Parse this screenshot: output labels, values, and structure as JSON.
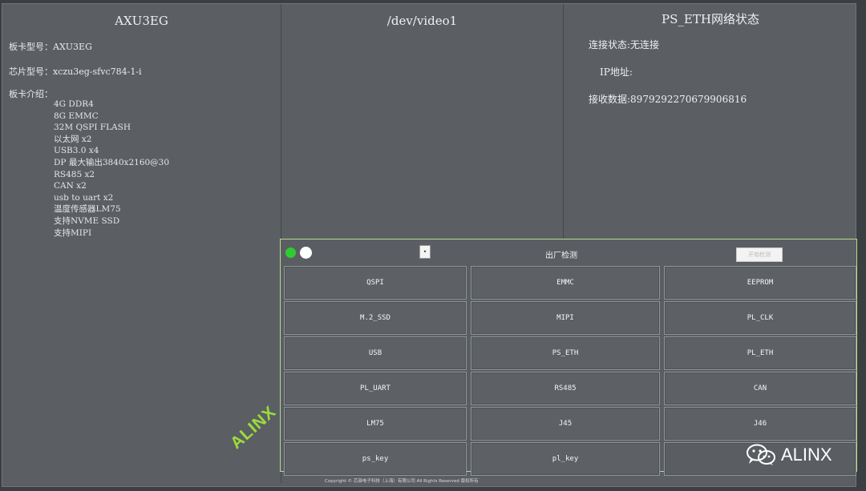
{
  "board": {
    "title": "AXU3EG",
    "model_line": "板卡型号：AXU3EG",
    "chip_line": "芯片型号：xczu3eg-sfvc784-1-i",
    "intro_label": "板卡介绍：",
    "features": [
      "4G DDR4",
      "8G EMMC",
      "32M QSPI FLASH",
      "以太网 x2",
      "USB3.0 x4",
      "DP 最大输出3840x2160@30",
      "RS485 x2",
      "CAN x2",
      "usb to uart x2",
      "温度传感器LM75",
      "支持NVME SSD",
      "支持MIPI"
    ]
  },
  "video": {
    "title": "/dev/video1"
  },
  "eth": {
    "title": "PS_ETH网络状态",
    "status_line": "连接状态:无连接",
    "ip_line": "IP地址:",
    "rx_line": "接收数据:8979292270679906816"
  },
  "factory": {
    "title": "出厂检测",
    "dropdown_glyph": "▾",
    "action_label": "开始检测",
    "tests": [
      [
        "QSPI",
        "EMMC",
        "EEPROM"
      ],
      [
        "M.2_SSD",
        "MIPI",
        "PL_CLK"
      ],
      [
        "USB",
        "PS_ETH",
        "PL_ETH"
      ],
      [
        "PL_UART",
        "RS485",
        "CAN"
      ],
      [
        "LM75",
        "J45",
        "J46"
      ],
      [
        "ps_key",
        "pl_key",
        ""
      ]
    ]
  },
  "footer": {
    "copyright": "Copyright © 芯驿电子科技（上海）有限公司 All Rights Reserved 版权所有"
  },
  "watermarks": {
    "alinx": "ALINX",
    "wechat": "ALINX"
  },
  "colors": {
    "accent_green": "#9bdc3a",
    "toggle_on": "#2ecc2e",
    "panel_bg": "#5b5f64"
  }
}
